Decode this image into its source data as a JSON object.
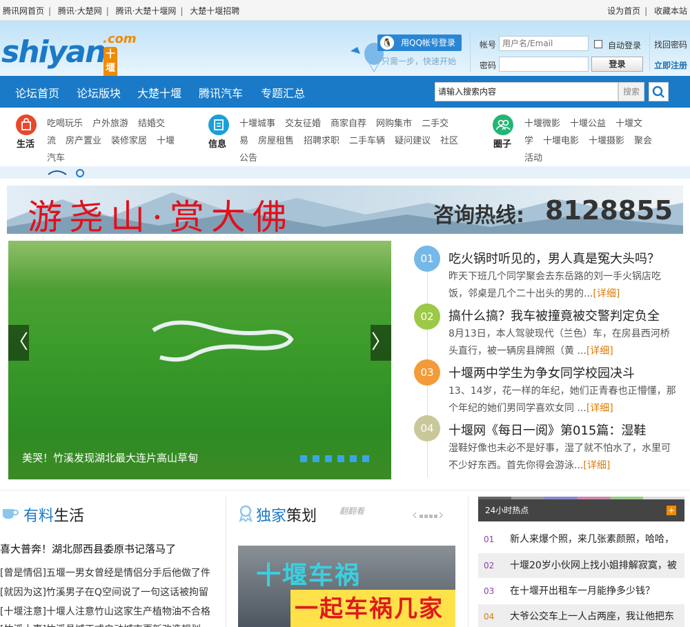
{
  "topbar": {
    "links": [
      "腾讯网首页",
      "腾讯·大楚网",
      "腾讯·大楚十堰网",
      "大楚十堰招聘"
    ],
    "right": [
      "设为首页",
      "收藏本站"
    ]
  },
  "header": {
    "logo_main": "shiyan",
    "logo_com": ".com",
    "logo_cn": "十堰网",
    "qq_login": "用QQ帐号登录",
    "qq_tip": "只需一步，快速开始",
    "account_label": "帐号",
    "account_placeholder": "用户名/Email",
    "password_label": "密码",
    "auto_login": "自动登录",
    "login_button": "登录",
    "forgot": "找回密码",
    "register": "立即注册"
  },
  "nav": {
    "items": [
      "论坛首页",
      "论坛版块",
      "大楚十堰",
      "腾讯汽车",
      "专题汇总"
    ],
    "search_placeholder": "请输入搜索内容",
    "search_button": "搜索"
  },
  "categories": {
    "life": {
      "title": "生活",
      "color": "#e8482b",
      "line1": [
        "吃喝玩乐",
        "户外旅游",
        "结婚交"
      ],
      "line2": [
        "流",
        "房产置业",
        "装修家居",
        "十堰"
      ],
      "line3": [
        "汽车"
      ]
    },
    "info": {
      "title": "信息",
      "color": "#1aa0d8",
      "line1": [
        "十堰城事",
        "交友征婚",
        "商家自荐",
        "网购集市",
        "二手交"
      ],
      "line2": [
        "易",
        "房屋租售",
        "招聘求职",
        "二手车辆",
        "疑问建议",
        "社区"
      ],
      "line3": [
        "公告"
      ]
    },
    "circle": {
      "title": "圈子",
      "color": "#22b574",
      "line1": [
        "十堰微影",
        "十堰公益",
        "十堰文"
      ],
      "line2": [
        "学",
        "十堰电影",
        "十堰摄影",
        "聚会"
      ],
      "line3": [
        "活动"
      ]
    }
  },
  "banner": {
    "slogan": "游尧山·赏大佛",
    "hotline_label": "咨询热线:",
    "hotline_number": "8128855"
  },
  "slider": {
    "caption": "美哭！竹溪发现湖北最大连片高山草甸",
    "prev": "〈",
    "next": "〉",
    "dot_count": 6
  },
  "news": [
    {
      "num": "01",
      "color": "#76b8e8",
      "title": "吃火锅时听见的，男人真是冤大头吗？",
      "summary": "昨天下班几个同学聚会去东岳路的刘一手火锅店吃饭，邻桌是几个二十出头的男的...",
      "more": "[详细]"
    },
    {
      "num": "02",
      "color": "#9cc947",
      "title": "搞什么搞？我车被撞竟被交警判定负全",
      "summary": "8月13日，本人驾驶现代（兰色）车，在房县西河桥头直行，被一辆房县牌照（黄 ...",
      "more": "[详细]"
    },
    {
      "num": "03",
      "color": "#f39b3a",
      "title": "十堰两中学生为争女同学校园决斗",
      "summary": "13、14岁，花一样的年纪，她们正青春也正懵懂，那个年纪的她们男同学喜欢女同 ...",
      "more": "[详细]"
    },
    {
      "num": "04",
      "color": "#c8c89a",
      "title": "十堰网《每日一阅》第015篇：湿鞋",
      "summary": "湿鞋好像也未必不是好事，湿了就不怕水了，水里可不少好东西。首先你得会游泳...",
      "more": "[详细]"
    }
  ],
  "life_section": {
    "title_a": "有料",
    "title_b": "生活",
    "headline": "喜大普奔！湖北郧西县委原书记落马了",
    "items": [
      "[曾是情侣]五堰一男女曾经是情侣分手后他做了件",
      "[就因为这]竹溪男子在Q空间说了一句这话被拘留",
      "[十堰注意]十堰人注意竹山这家生产植物油不合格",
      "[竹溪大事]竹溪县城正式启动城市更新改造规划"
    ]
  },
  "special_section": {
    "title_a": "独家",
    "title_b": "策划",
    "flip": "翻翻看",
    "promo_line1": "十堰车祸",
    "promo_line2": "一起车祸几家泪"
  },
  "hot": {
    "title": "24小时热点",
    "plus": "+",
    "items": [
      {
        "num": "01",
        "text": "新人来爆个照，来几张素颜照，哈哈，"
      },
      {
        "num": "02",
        "text": "十堰20岁小伙网上找小姐排解寂寞，被"
      },
      {
        "num": "03",
        "text": "在十堰开出租车一月能挣多少钱？"
      },
      {
        "num": "04",
        "text": "大爷公交车上一人占两座，我让他把东"
      }
    ]
  }
}
